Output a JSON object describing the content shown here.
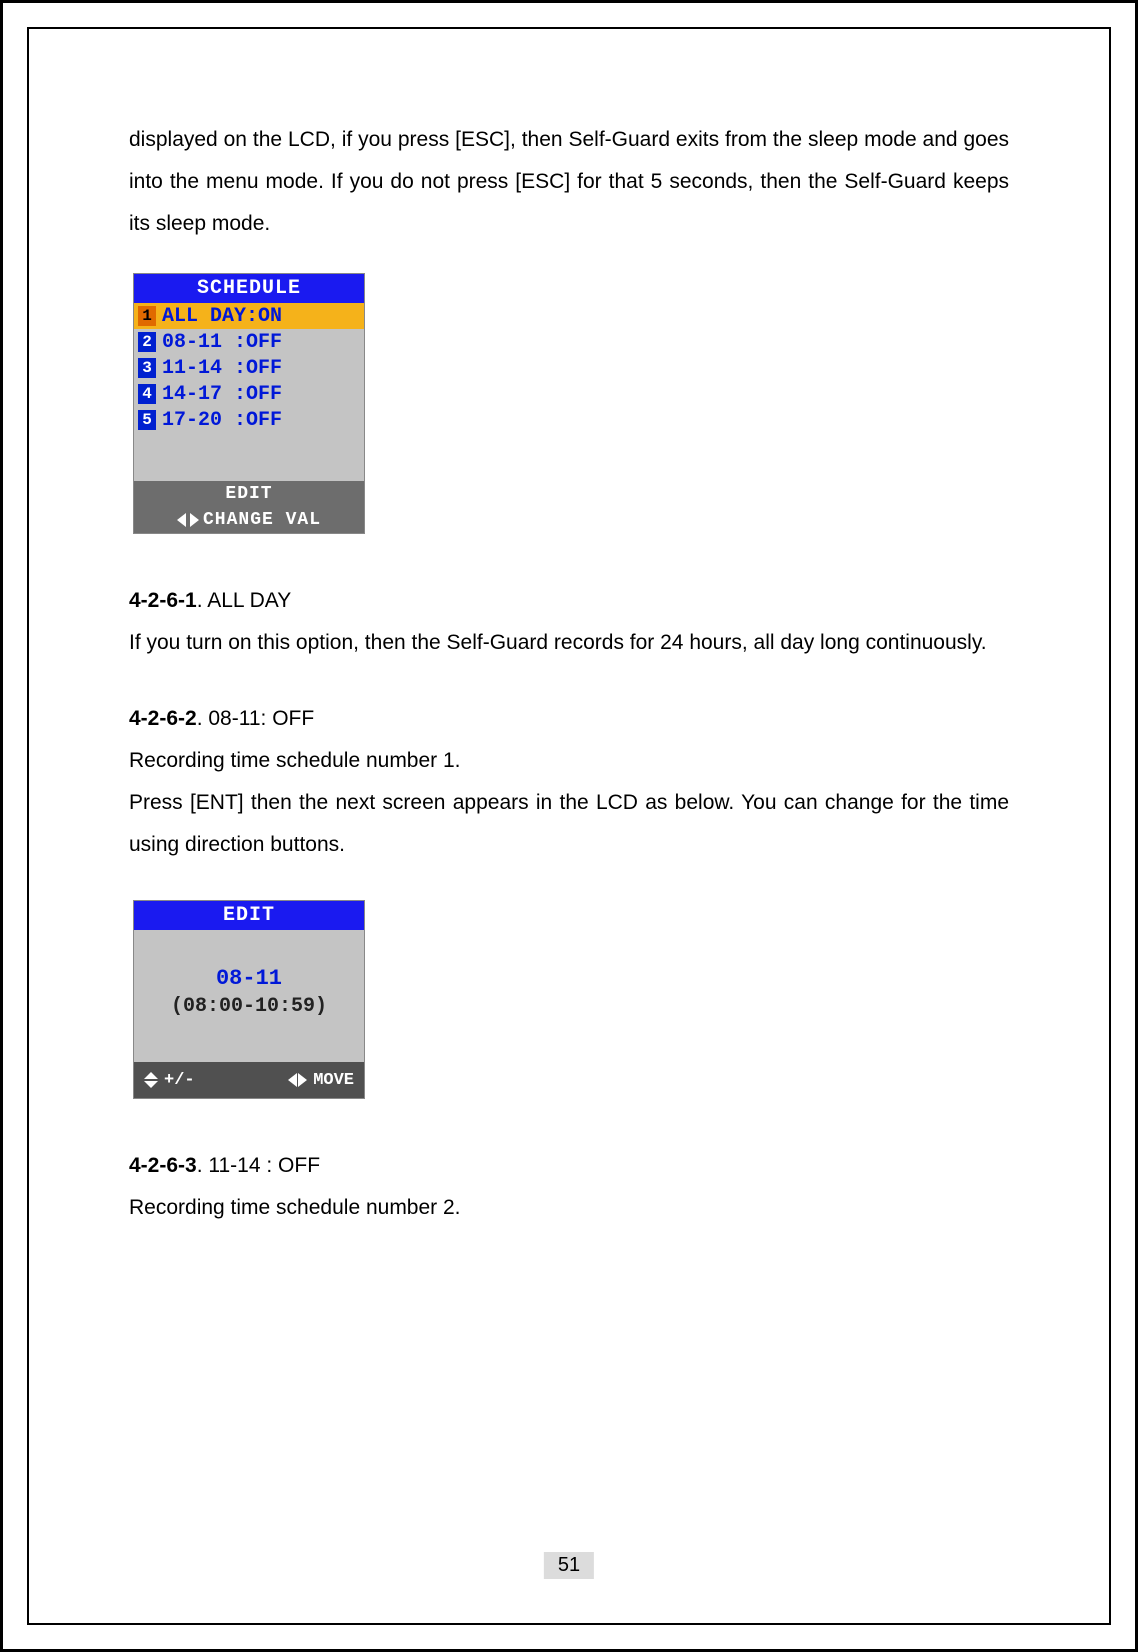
{
  "intro_paragraph": "displayed on the LCD, if you press [ESC], then Self-Guard exits from the sleep mode and goes into the menu mode. If you do not press [ESC] for that 5 seconds, then the Self-Guard keeps its sleep mode.",
  "schedule_screen": {
    "title": "SCHEDULE",
    "rows": [
      {
        "index": "1",
        "label": "ALL DAY:ON",
        "selected": true
      },
      {
        "index": "2",
        "label": " 08-11 :OFF",
        "selected": false
      },
      {
        "index": "3",
        "label": " 11-14 :OFF",
        "selected": false
      },
      {
        "index": "4",
        "label": " 14-17 :OFF",
        "selected": false
      },
      {
        "index": "5",
        "label": " 17-20 :OFF",
        "selected": false
      }
    ],
    "footer_line1": "EDIT",
    "footer_line2": "CHANGE VAL"
  },
  "sections": [
    {
      "num": "4-2-6-1",
      "title": ". ALL DAY",
      "body": "If you turn on this option, then the Self-Guard records for 24 hours, all day long continuously."
    },
    {
      "num": "4-2-6-2",
      "title": ". 08-11: OFF",
      "body": "Recording time schedule number 1.",
      "body2": "Press [ENT] then the next screen appears in the LCD as below. You can change for the time using direction buttons."
    },
    {
      "num": "4-2-6-3",
      "title": ". 11-14 : OFF",
      "body": "Recording time schedule number 2."
    }
  ],
  "edit_screen": {
    "title": "EDIT",
    "range_short": "08-11",
    "range_full": "(08:00-10:59)",
    "footer_left": "+/-",
    "footer_right": "MOVE"
  },
  "page_number": "51"
}
